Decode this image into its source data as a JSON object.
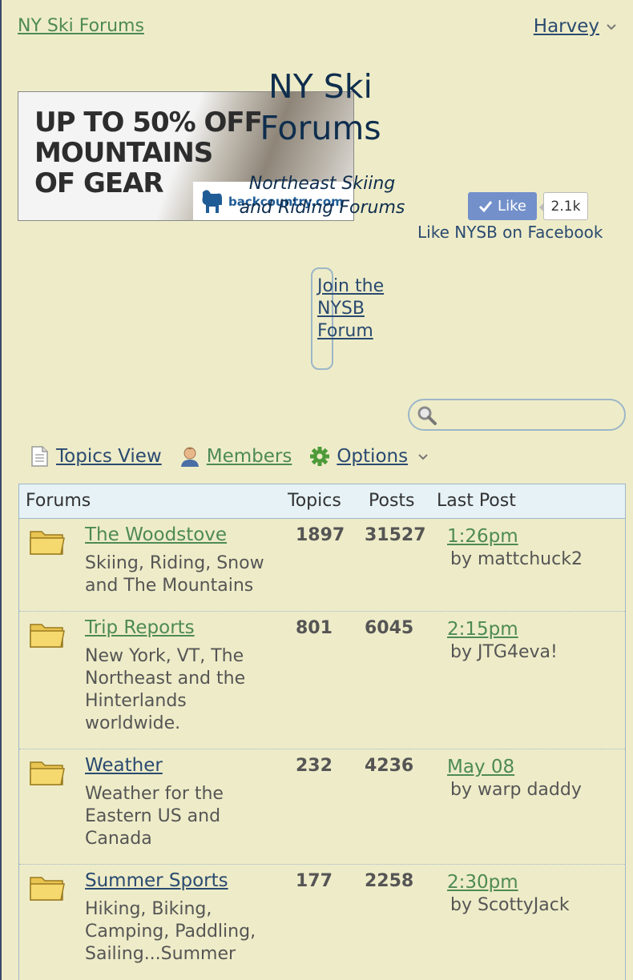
{
  "header": {
    "home_link": "NY Ski Forums",
    "user_name": "Harvey",
    "user_chevron": "⌄"
  },
  "ad": {
    "lines": [
      "UP TO 50% OFF",
      "MOUNTAINS",
      "OF GEAR"
    ],
    "brand": "backcountry.com"
  },
  "site": {
    "title": "NY Ski Forums",
    "subtitle": "Northeast Skiing and Riding Forums"
  },
  "facebook": {
    "like_label": "Like",
    "like_count": "2.1k",
    "caption": "Like NYSB on Facebook",
    "accent": "#7390CA"
  },
  "join_link": "Join the NYSB Forum",
  "search": {
    "placeholder": "",
    "icon": "search-icon"
  },
  "nav": {
    "topics_view": "Topics View",
    "members": "Members",
    "options": "Options"
  },
  "table": {
    "headers": {
      "forums": "Forums",
      "topics": "Topics",
      "posts": "Posts",
      "last_post": "Last Post"
    },
    "rows": [
      {
        "name": "The Woodstove",
        "description": "Skiing, Riding, Snow and The Mountains",
        "topics": "1897",
        "posts": "31527",
        "last_time": "1:26pm",
        "last_by": "by mattchuck2"
      },
      {
        "name": "Trip Reports",
        "description": "New York, VT, The Northeast and the Hinterlands worldwide.",
        "topics": "801",
        "posts": "6045",
        "last_time": "2:15pm",
        "last_by": "by JTG4eva!"
      },
      {
        "name": "Weather",
        "description": "Weather for the Eastern US and Canada",
        "topics": "232",
        "posts": "4236",
        "last_time": "May 08",
        "last_by": "by warp daddy"
      },
      {
        "name": "Summer Sports",
        "description": "Hiking, Biking, Camping, Paddling, Sailing...Summer",
        "topics": "177",
        "posts": "2258",
        "last_time": "2:30pm",
        "last_by": "by ScottyJack"
      }
    ]
  },
  "colors": {
    "background": "#EEECC8",
    "link_green": "#4E8A55",
    "link_blue": "#2A4A70",
    "title_navy": "#0F2E4E",
    "table_border": "#9CB6C8",
    "header_bg": "#E6F2F6"
  }
}
